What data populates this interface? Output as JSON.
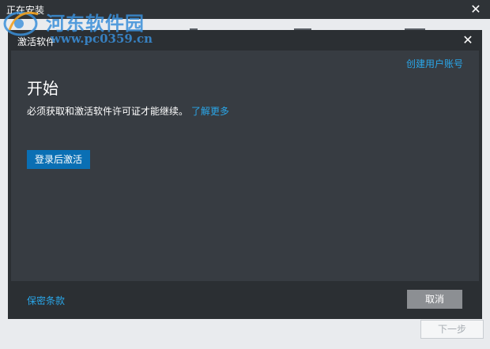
{
  "outer_window": {
    "title": "正在安装",
    "next_label": "下一步"
  },
  "watermark": {
    "site_name": "河东软件园",
    "url": "www.pc0359.cn"
  },
  "dialog": {
    "title": "激活软件",
    "create_account_label": "创建用户账号",
    "heading": "开始",
    "description": "必须获取和激活软件许可证才能继续。",
    "learn_more_label": "了解更多",
    "signin_label": "登录后激活",
    "privacy_label": "保密条款",
    "cancel_label": "取消"
  },
  "colors": {
    "link": "#2aa6e8",
    "primary_button": "#0a6fb4",
    "dialog_bg": "#2b2f33",
    "panel_bg": "#373c42"
  }
}
